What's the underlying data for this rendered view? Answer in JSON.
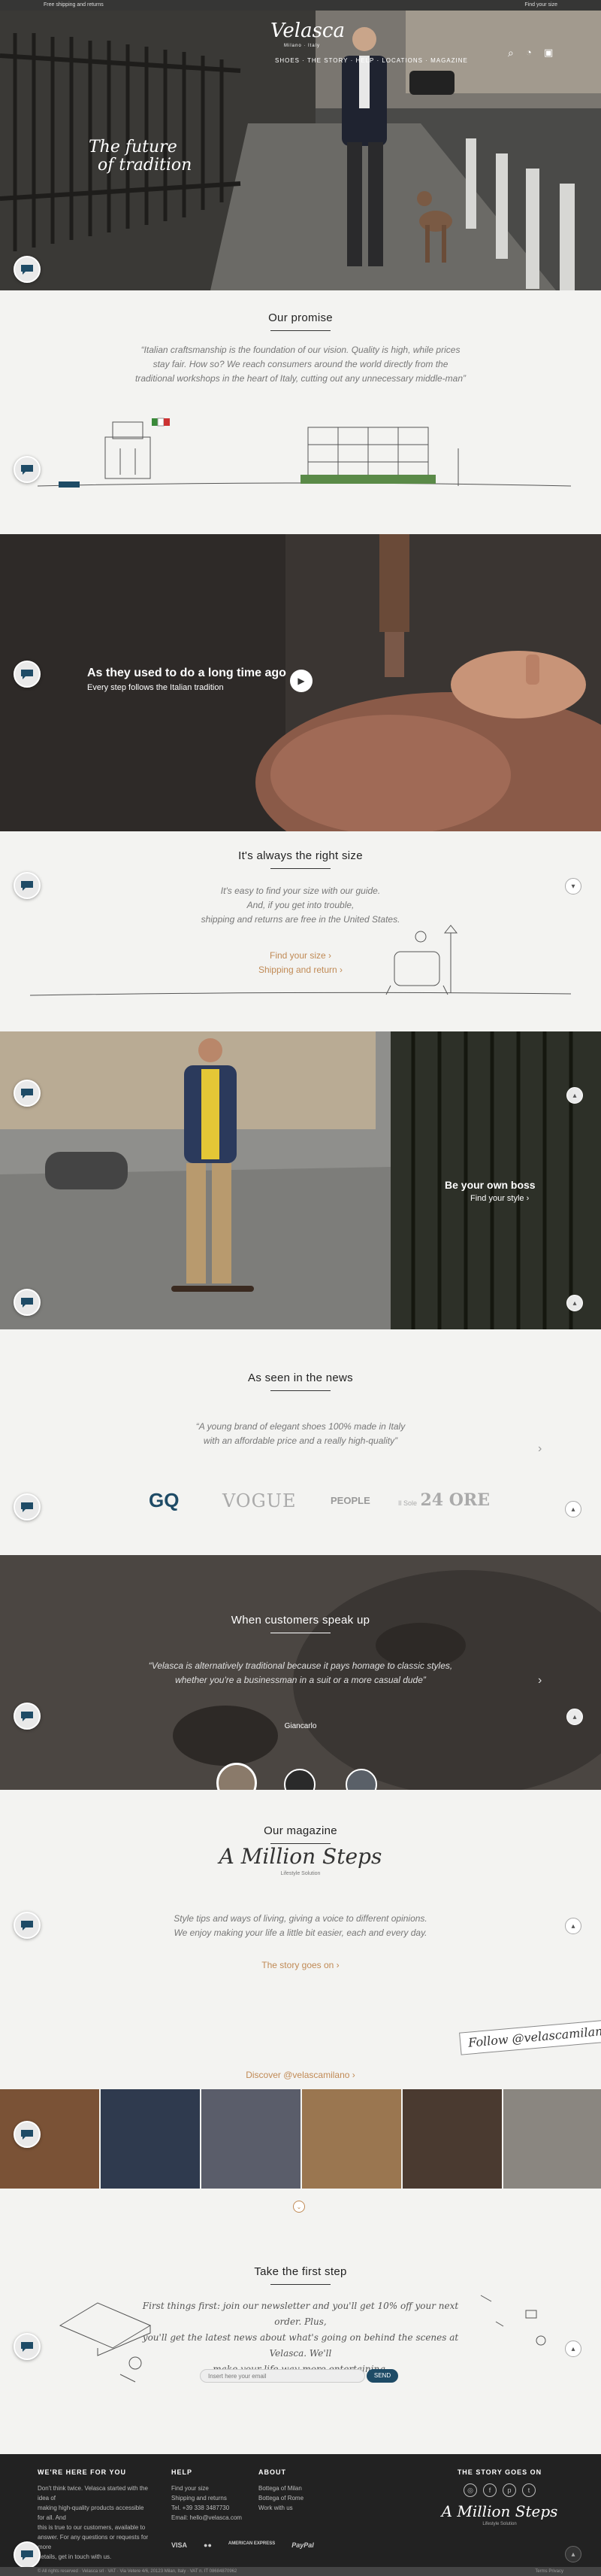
{
  "topbar": {
    "left": "Free shipping and returns",
    "right": "Find your size"
  },
  "brand": {
    "name": "Velasca",
    "sub": "Milano · Italy"
  },
  "nav": {
    "items": [
      "SHOES",
      "THE STORY",
      "HELP",
      "LOCATIONS",
      "MAGAZINE"
    ]
  },
  "hero": {
    "line1": "The future",
    "line2": "of tradition"
  },
  "promise": {
    "title": "Our promise",
    "quote": "“Italian craftsmanship is the foundation of our vision. Quality is high, while prices stay fair. How so? We reach consumers around the world directly from the traditional workshops in the heart of Italy, cutting out any unnecessary middle-man”"
  },
  "tradition": {
    "title": "As they used to do a long time ago",
    "subtitle": "Every step follows the Italian tradition"
  },
  "size": {
    "title": "It's always the right size",
    "line1": "It's easy to find your size with our guide.",
    "line2": "And, if you get into trouble,",
    "line3": "shipping and returns are free in the United States.",
    "link1": "Find your size ›",
    "link2": "Shipping and return ›"
  },
  "boss": {
    "title": "Be your own boss",
    "link": "Find your style ›"
  },
  "news": {
    "title": "As seen in the news",
    "quote1": "“A young brand of elegant shoes 100% made in Italy",
    "quote2": "with an affordable price and a really high-quality”",
    "logos": [
      "GQ",
      "VOGUE",
      "PEOPLE",
      "24 ORE"
    ],
    "logo_pre": "Il Sole"
  },
  "customers": {
    "title": "When customers speak up",
    "quote1": "“Velasca is alternatively traditional because it pays homage to classic styles,",
    "quote2": "whether you're a businessman in a suit or a more casual dude”",
    "author": "Giancarlo"
  },
  "magazine": {
    "title": "Our magazine",
    "logo": "A Million Steps",
    "logo_sub": "Lifestyle Solution",
    "line1": "Style tips and ways of living, giving a voice to different opinions.",
    "line2": "We enjoy making your life a little bit easier, each and every day.",
    "link": "The story goes on ›",
    "follow": "Follow @velascamilano on",
    "discover": "Discover @velascamilano ›"
  },
  "firststep": {
    "title": "Take the first step",
    "line1": "First things first: join our newsletter and you'll get 10% off your next order. Plus,",
    "line2": "you'll get the latest news about what's going on behind the scenes at Velasca. We'll",
    "line3": "make your life way more entertaining.",
    "placeholder": "Insert here your email",
    "button": "SEND"
  },
  "footer": {
    "col1_title": "WE'RE HERE FOR YOU",
    "col1_text1": "Don't think twice. Velasca started with the idea of",
    "col1_text2": "making high-quality products accessible for all. And",
    "col1_text3": "this is true to our customers, available to",
    "col1_text4": "answer. For any questions or requests for more",
    "col1_text5": "details, get in touch with us.",
    "col2_title": "HELP",
    "col2_items": [
      "Find your size",
      "Shipping and returns",
      "Tel. +39 338 3487730",
      "Email: hello@velasca.com"
    ],
    "col3_title": "ABOUT",
    "col3_items": [
      "Bottega of Milan",
      "Bottega of Rome",
      "Work with us"
    ],
    "col4_title": "THE STORY GOES ON",
    "col4_logo": "A Million Steps",
    "col4_sub": "Lifestyle Solution",
    "payments": [
      "VISA",
      "●●",
      "AMERICAN EXPRESS",
      "PayPal"
    ],
    "bottom_left": "© All rights reserved · Velasca srl · VAT · Via Vetere 4/6, 20123 Milan, Italy · VAT n. IT 08684870962",
    "bottom_right": "Terms Privacy"
  },
  "colors": {
    "accent": "#c08a55",
    "dark": "#222222",
    "bg": "#f3f3f1",
    "button": "#1e4b66"
  }
}
